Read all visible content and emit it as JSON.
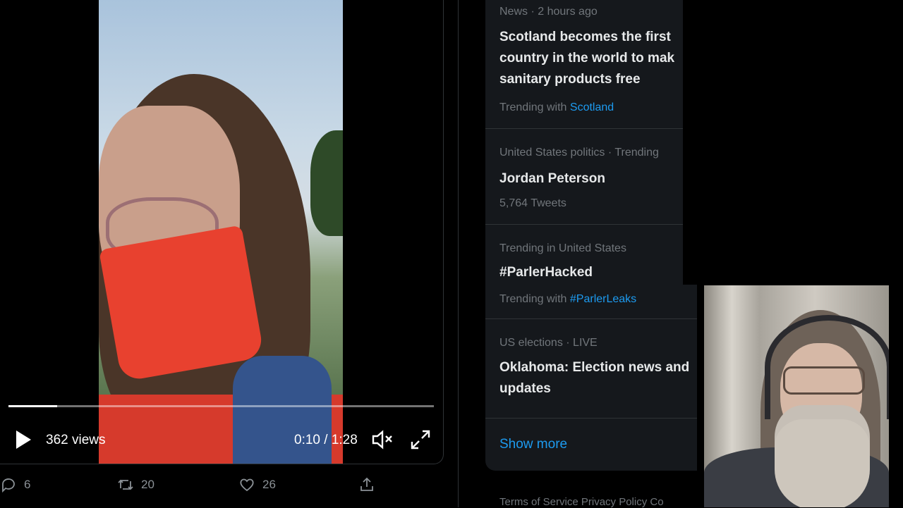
{
  "video": {
    "views": "362 views",
    "time": "0:10 / 1:28",
    "progress_fraction": 0.115
  },
  "tweet_actions": {
    "replies": "6",
    "retweets": "20",
    "likes": "26"
  },
  "trends": [
    {
      "meta": "News · 2 hours ago",
      "title": "Scotland becomes the first\ncountry in the world to mak\nsanitary products free",
      "sub_prefix": "Trending with ",
      "sub_link": "Scotland"
    },
    {
      "meta": "United States politics · Trending",
      "title": "Jordan Peterson",
      "sub_prefix": "5,764 Tweets",
      "sub_link": ""
    },
    {
      "meta": "Trending in United States",
      "title": "#ParlerHacked",
      "sub_prefix": "Trending with ",
      "sub_link": "#ParlerLeaks"
    },
    {
      "meta": "US elections · LIVE",
      "title": "Oklahoma: Election news and\nupdates",
      "sub_prefix": "",
      "sub_link": ""
    }
  ],
  "show_more": "Show more",
  "footer": "Terms of Service   Privacy Policy   Co",
  "icons": {
    "play": "play-icon",
    "volume": "volume-icon",
    "fullscreen": "fullscreen-icon",
    "reply": "reply-icon",
    "retweet": "retweet-icon",
    "like": "heart-icon",
    "share": "share-icon"
  },
  "colors": {
    "link": "#1d9bf0",
    "panel": "#15181c",
    "muted": "#71767b"
  }
}
